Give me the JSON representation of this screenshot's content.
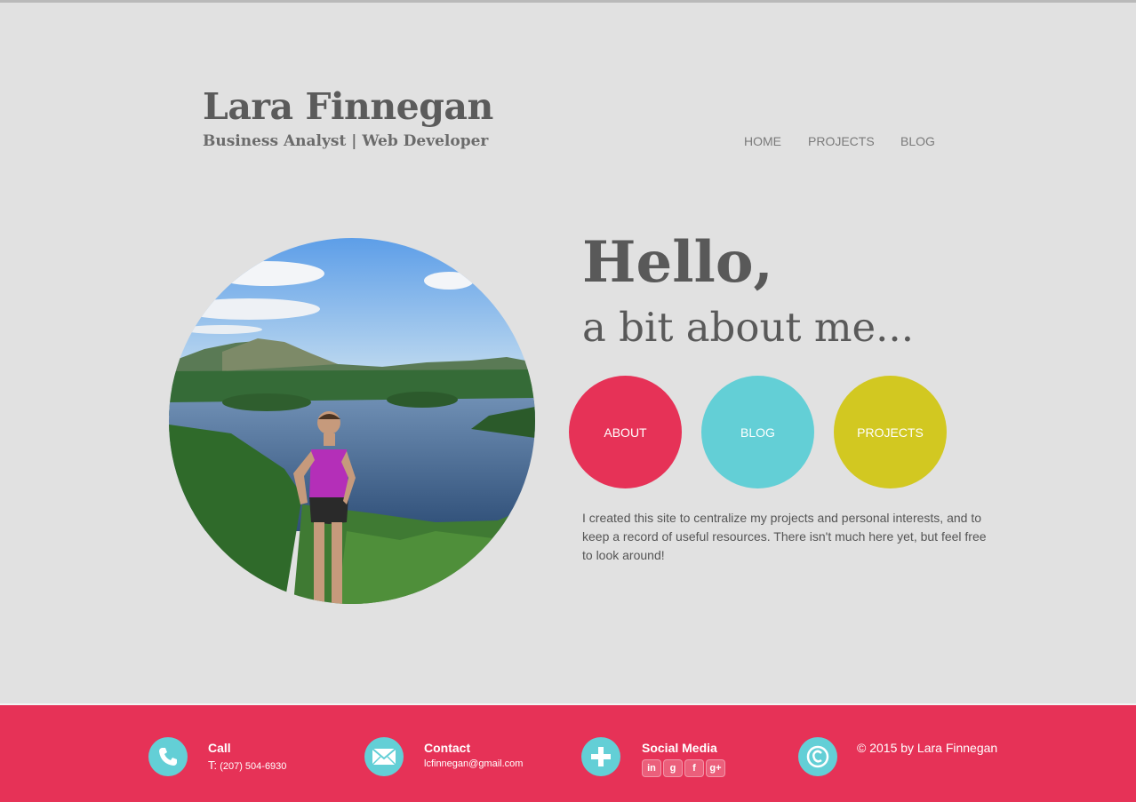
{
  "header": {
    "name": "Lara Finnegan",
    "subtitle": "Business Analyst | Web Developer"
  },
  "nav": {
    "items": [
      {
        "label": "HOME"
      },
      {
        "label": "PROJECTS"
      },
      {
        "label": "BLOG"
      }
    ]
  },
  "hero": {
    "greeting": "Hello,",
    "tagline": "a bit about me...",
    "buttons": [
      {
        "label": "ABOUT",
        "color": "#e63257"
      },
      {
        "label": "BLOG",
        "color": "#63cfd6"
      },
      {
        "label": "PROJECTS",
        "color": "#d2c821"
      }
    ],
    "intro": "I created this site to centralize my projects and personal interests, and to keep a record of useful resources. There isn't much here yet, but feel free to look around!"
  },
  "footer": {
    "background": "#e63257",
    "icon_color": "#63cfd6",
    "call": {
      "title": "Call",
      "prefix": "T:",
      "phone": "(207) 504-6930",
      "icon": "phone-icon"
    },
    "contact": {
      "title": "Contact",
      "email": "lcfinnegan@gmail.com",
      "icon": "envelope-icon"
    },
    "social": {
      "title": "Social Media",
      "icon": "plus-icon",
      "links": [
        {
          "label": "in",
          "icon": "linkedin-icon"
        },
        {
          "label": "g",
          "icon": "goodreads-icon"
        },
        {
          "label": "f",
          "icon": "facebook-icon"
        },
        {
          "label": "g+",
          "icon": "google-plus-icon"
        }
      ]
    },
    "copyright": {
      "text": "© 2015 by Lara Finnegan",
      "icon": "copyright-icon"
    }
  }
}
